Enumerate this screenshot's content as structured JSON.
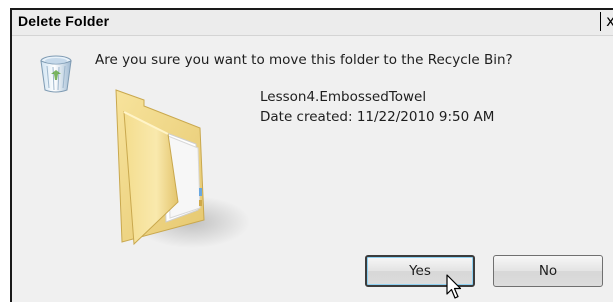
{
  "dialog": {
    "title": "Delete Folder",
    "close_glyph": "x",
    "message": "Are you sure you want to move this folder to the Recycle Bin?",
    "item": {
      "name": "Lesson4.EmbossedTowel",
      "date_created": "Date created: 11/22/2010 9:50 AM"
    },
    "buttons": {
      "yes_label": "Yes",
      "no_label": "No"
    },
    "icons": {
      "recycle_bin": "recycle-bin-icon",
      "folder": "folder-icon",
      "cursor": "mouse-pointer-icon"
    }
  }
}
